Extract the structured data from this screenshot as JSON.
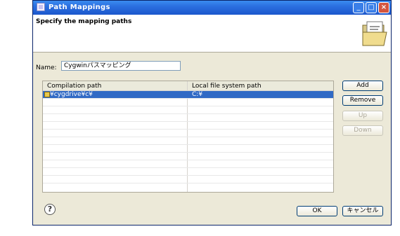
{
  "window": {
    "title": "Path Mappings",
    "banner_text": "Specify the mapping paths"
  },
  "name_field": {
    "label": "Name:",
    "value": "Cygwinパスマッピング"
  },
  "table": {
    "columns": [
      "Compilation path",
      "Local file system path"
    ],
    "rows": [
      {
        "compilation": "¥cygdrive¥c¥",
        "local": "C:¥",
        "selected": true
      }
    ],
    "empty_row_count": 11
  },
  "buttons": {
    "add": "Add",
    "remove": "Remove",
    "up": "Up",
    "down": "Down",
    "ok": "OK",
    "cancel": "キャンセル"
  },
  "help_icon": "?"
}
